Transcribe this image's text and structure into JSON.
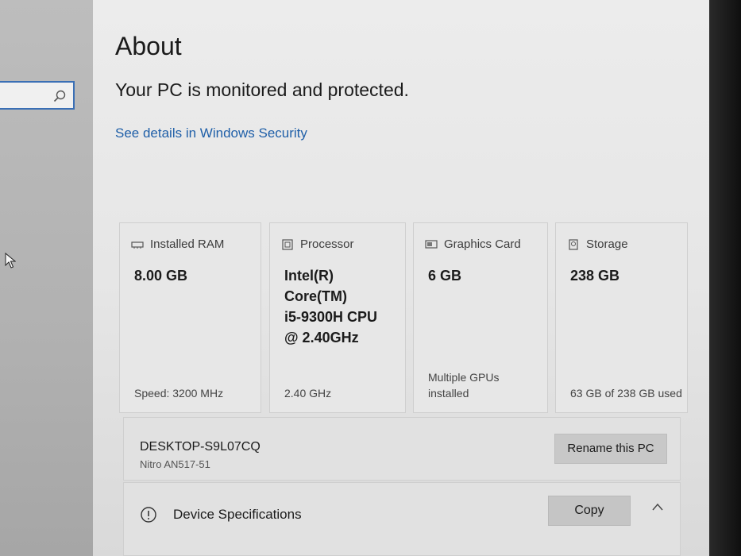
{
  "left_pane": {
    "search": {
      "value": "",
      "placeholder": ""
    }
  },
  "about": {
    "title": "About",
    "protection_status": "Your PC is monitored and protected.",
    "security_link": "See details in Windows Security"
  },
  "specs_cards": [
    {
      "icon": "ram-icon",
      "label": "Installed RAM",
      "value": "8.00 GB",
      "footer": "Speed: 3200 MHz"
    },
    {
      "icon": "processor-icon",
      "label": "Processor",
      "value_lines": [
        "Intel(R)",
        "Core(TM)",
        "i5-9300H CPU",
        "@ 2.40GHz"
      ],
      "footer": "2.40 GHz"
    },
    {
      "icon": "graphics-card-icon",
      "label": "Graphics Card",
      "value": "6 GB",
      "footer_lines": [
        "Multiple GPUs",
        "installed"
      ]
    },
    {
      "icon": "storage-icon",
      "label": "Storage",
      "value": "238 GB",
      "footer": "63 GB of 238 GB used"
    }
  ],
  "device": {
    "name": "DESKTOP-S9L07CQ",
    "model": "Nitro AN517-51",
    "rename_label": "Rename this PC"
  },
  "device_specifications": {
    "title": "Device Specifications",
    "copy_label": "Copy"
  }
}
